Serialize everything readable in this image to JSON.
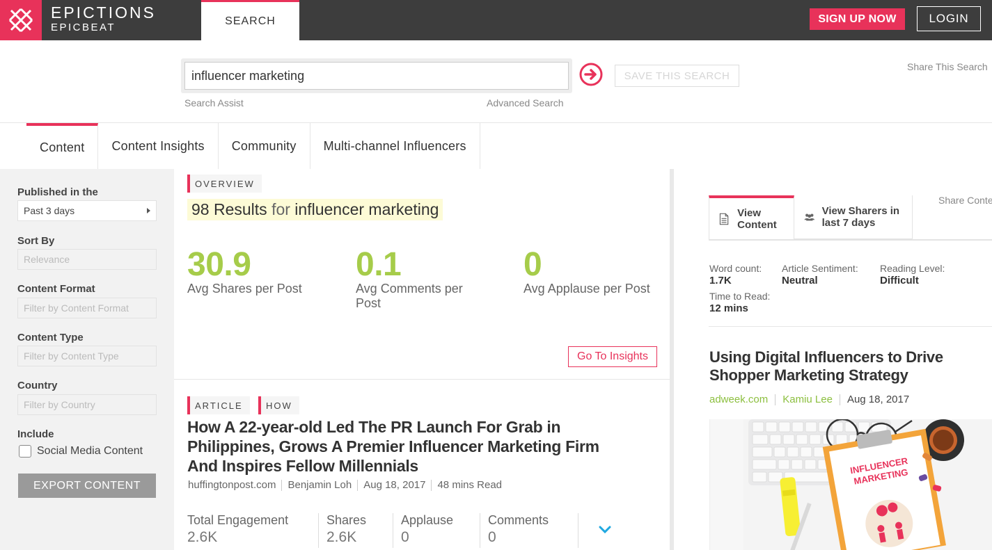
{
  "header": {
    "brand_line1": "EPICTIONS",
    "brand_line2": "EPICBEAT",
    "search_tab": "SEARCH",
    "signup_label": "SIGN UP NOW",
    "login_label": "LOGIN"
  },
  "search": {
    "query": "influencer marketing",
    "assist_label": "Search Assist",
    "advanced_label": "Advanced Search",
    "save_label": "SAVE THIS SEARCH",
    "share_label": "Share This Search"
  },
  "nav": {
    "tabs": [
      "Content",
      "Content Insights",
      "Community",
      "Multi-channel Influencers"
    ],
    "active": "Content"
  },
  "filters": {
    "published_label": "Published in the",
    "published_value": "Past 3 days",
    "sort_label": "Sort By",
    "sort_placeholder": "Relevance",
    "format_label": "Content Format",
    "format_placeholder": "Filter by Content Format",
    "type_label": "Content Type",
    "type_placeholder": "Filter by Content Type",
    "country_label": "Country",
    "country_placeholder": "Filter by Country",
    "include_label": "Include",
    "social_label": "Social Media Content",
    "export_label": "EXPORT CONTENT"
  },
  "overview": {
    "tag": "OVERVIEW",
    "count": "98 Results",
    "for_word": "for",
    "query": "influencer marketing",
    "stats": [
      {
        "value": "30.9",
        "label": "Avg Shares per Post"
      },
      {
        "value": "0.1",
        "label": "Avg Comments per Post"
      },
      {
        "value": "0",
        "label": "Avg Applause per Post"
      }
    ],
    "insights_label": "Go To Insights"
  },
  "article": {
    "tags": [
      "ARTICLE",
      "HOW"
    ],
    "title": "How A 22-year-old Led The PR Launch For Grab in Philippines, Grows A Premier Influencer Marketing Firm And Inspires Fellow Millennials",
    "source": "huffingtonpost.com",
    "author": "Benjamin Loh",
    "date": "Aug 18, 2017",
    "read_time": "48 mins Read",
    "engagement": [
      {
        "label": "Total Engagement",
        "value": "2.6K"
      },
      {
        "label": "Shares",
        "value": "2.6K"
      },
      {
        "label": "Applause",
        "value": "0"
      },
      {
        "label": "Comments",
        "value": "0"
      }
    ]
  },
  "detail": {
    "tab_view_content": "View Content",
    "tab_view_sharers": "View Sharers in last 7 days",
    "share_label": "Share Conte",
    "word_count_label": "Word count:",
    "word_count": "1.7K",
    "sentiment_label": "Article Sentiment:",
    "sentiment": "Neutral",
    "reading_level_label": "Reading Level:",
    "reading_level": "Difficult",
    "time_label": "Time to Read:",
    "time": "12 mins",
    "title": "Using Digital Influencers to Drive Shopper Marketing Strategy",
    "source": "adweek.com",
    "author": "Kamiu Lee",
    "date": "Aug 18, 2017",
    "image_text_line1": "INFLUENCER",
    "image_text_line2": "MARKETING"
  },
  "colors": {
    "accent": "#e8325a",
    "stat_green": "#a6cc4a",
    "header_bg": "#3d3d3d"
  }
}
